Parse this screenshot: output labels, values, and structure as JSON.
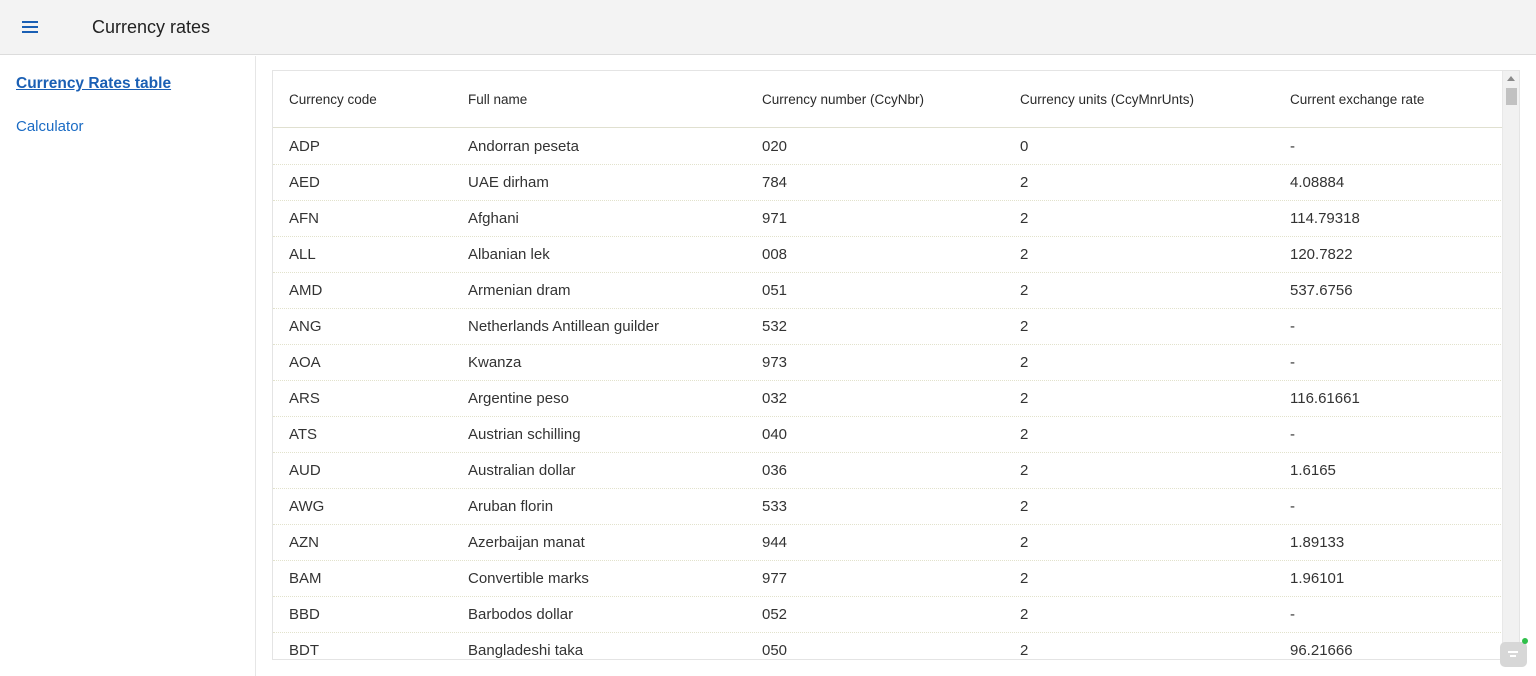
{
  "header": {
    "title": "Currency rates",
    "menu_icon": "hamburger-menu-icon"
  },
  "sidebar": {
    "items": [
      {
        "label": "Currency Rates table",
        "active": true
      },
      {
        "label": "Calculator",
        "active": false
      }
    ]
  },
  "table": {
    "columns": [
      "Currency code",
      "Full name",
      "Currency number (CcyNbr)",
      "Currency units (CcyMnrUnts)",
      "Current exchange rate"
    ],
    "rows": [
      [
        "ADP",
        "Andorran peseta",
        "020",
        "0",
        "-"
      ],
      [
        "AED",
        "UAE dirham",
        "784",
        "2",
        "4.08884"
      ],
      [
        "AFN",
        "Afghani",
        "971",
        "2",
        "114.79318"
      ],
      [
        "ALL",
        "Albanian lek",
        "008",
        "2",
        "120.7822"
      ],
      [
        "AMD",
        "Armenian dram",
        "051",
        "2",
        "537.6756"
      ],
      [
        "ANG",
        "Netherlands Antillean guilder",
        "532",
        "2",
        "-"
      ],
      [
        "AOA",
        "Kwanza",
        "973",
        "2",
        "-"
      ],
      [
        "ARS",
        "Argentine peso",
        "032",
        "2",
        "116.61661"
      ],
      [
        "ATS",
        "Austrian schilling",
        "040",
        "2",
        "-"
      ],
      [
        "AUD",
        "Australian dollar",
        "036",
        "2",
        "1.6165"
      ],
      [
        "AWG",
        "Aruban florin",
        "533",
        "2",
        "-"
      ],
      [
        "AZN",
        "Azerbaijan manat",
        "944",
        "2",
        "1.89133"
      ],
      [
        "BAM",
        "Convertible marks",
        "977",
        "2",
        "1.96101"
      ],
      [
        "BBD",
        "Barbodos dollar",
        "052",
        "2",
        "-"
      ],
      [
        "BDT",
        "Bangladeshi taka",
        "050",
        "2",
        "96.21666"
      ]
    ]
  },
  "colors": {
    "accent": "#1a5fb4",
    "link": "#1a6bc4",
    "topbar_bg": "#f3f3f3",
    "status_dot": "#2fbf4a"
  }
}
